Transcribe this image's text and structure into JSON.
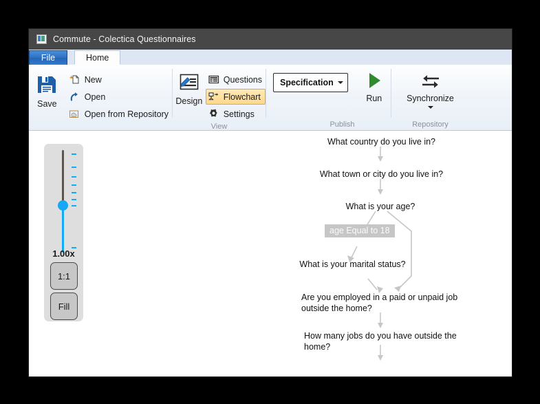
{
  "window": {
    "title": "Commute - Colectica Questionnaires",
    "app_icon": "app-window-icon"
  },
  "tabs": [
    {
      "id": "file",
      "label": "File"
    },
    {
      "id": "home",
      "label": "Home"
    }
  ],
  "ribbon": {
    "groups": [
      {
        "id": "file-actions",
        "label": "",
        "big_button": {
          "label": "Save",
          "icon": "save-disk-icon"
        },
        "small_items": [
          {
            "label": "New",
            "icon": "new-document-icon",
            "active": false
          },
          {
            "label": "Open",
            "icon": "open-arrow-icon",
            "active": false
          },
          {
            "label": "Open from Repository",
            "icon": "open-from-repository-icon",
            "active": false
          }
        ]
      },
      {
        "id": "view",
        "label": "View",
        "big_button": {
          "label": "Design",
          "icon": "design-pencil-icon"
        },
        "small_items": [
          {
            "label": "Questions",
            "icon": "questions-grid-icon",
            "active": false
          },
          {
            "label": "Flowchart",
            "icon": "flowchart-icon",
            "active": true
          },
          {
            "label": "Settings",
            "icon": "gear-icon",
            "active": false
          }
        ]
      },
      {
        "id": "publish",
        "label": "Publish",
        "combo": {
          "value": "Specification",
          "caret": "chevron-down-icon"
        },
        "big_button": {
          "label": "Run",
          "icon": "run-play-icon"
        }
      },
      {
        "id": "repository",
        "label": "Repository",
        "big_button": {
          "label": "Synchronize",
          "icon": "synchronize-arrows-icon",
          "caret": "chevron-down-icon"
        }
      }
    ]
  },
  "zoom_panel": {
    "value_label": "1.00x",
    "slider": {
      "name": "zoom-slider",
      "percent": 56
    },
    "buttons": [
      {
        "id": "one-to-one",
        "label": "1:1"
      },
      {
        "id": "fill",
        "label": "Fill"
      }
    ]
  },
  "flowchart": {
    "nodes": [
      {
        "id": "country",
        "text": "What country do you live in?"
      },
      {
        "id": "town",
        "text": "What town or city do you live in?"
      },
      {
        "id": "age",
        "text": "What is your age?"
      },
      {
        "id": "marital",
        "text": "What is your marital status?"
      },
      {
        "id": "employed",
        "text": "Are you employed in a paid or unpaid job outside the home?"
      },
      {
        "id": "jobs",
        "text": "How many jobs do you have outside the home?"
      }
    ],
    "conditions": [
      {
        "id": "age-cond",
        "text": "age Equal to 18"
      }
    ]
  },
  "colors": {
    "titlebar": "#474747",
    "accent_blue": "#14a8f5",
    "file_tab": "#2f72c4",
    "highlight_amber": "#ffd88a",
    "run_green": "#2e8b2e",
    "save_blue": "#1f5fa8",
    "edge_gray": "#c6c6c6"
  }
}
